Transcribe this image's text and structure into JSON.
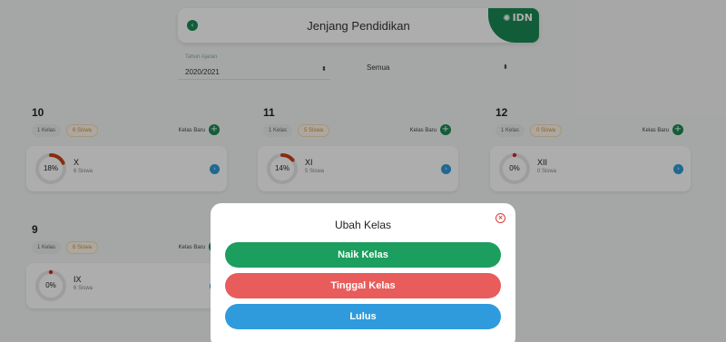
{
  "header": {
    "title": "Jenjang Pendidikan",
    "back_icon": "‹",
    "brand": "IDN",
    "brand_icon": "✺"
  },
  "filters": {
    "year": {
      "label": "Tahun Ajaran",
      "value": "2020/2021",
      "caret": "⬍"
    },
    "scope": {
      "value": "Semua",
      "caret": "⬍"
    }
  },
  "grades": [
    {
      "number": "10",
      "kelas_chip": "1 Kelas",
      "siswa_chip": "6 Siswa",
      "new_class_label": "Kelas Baru",
      "card": {
        "percent": "18%",
        "progress": 0.18,
        "name": "X",
        "count": "6 Siswa"
      }
    },
    {
      "number": "11",
      "kelas_chip": "1 Kelas",
      "siswa_chip": "5 Siswa",
      "new_class_label": "Kelas Baru",
      "card": {
        "percent": "14%",
        "progress": 0.14,
        "name": "XI",
        "count": "5 Siswa"
      }
    },
    {
      "number": "12",
      "kelas_chip": "1 Kelas",
      "siswa_chip": "0 Siswa",
      "new_class_label": "Kelas Baru",
      "card": {
        "percent": "0%",
        "progress": 0,
        "name": "XII",
        "count": "0 Siswa"
      }
    },
    {
      "number": "9",
      "kelas_chip": "1 Kelas",
      "siswa_chip": "6 Siswa",
      "new_class_label": "Kelas Baru",
      "card": {
        "percent": "0%",
        "progress": 0,
        "name": "IX",
        "count": "6 Siswa"
      }
    }
  ],
  "modal": {
    "title": "Ubah Kelas",
    "close_icon": "×",
    "buttons": {
      "naik": "Naik Kelas",
      "tinggal": "Tinggal Kelas",
      "lulus": "Lulus"
    }
  },
  "colors": {
    "brand_green": "#1b8a55",
    "danger": "#e85c5c",
    "info": "#2f9bdc",
    "ring_accent": "#c8431b"
  }
}
